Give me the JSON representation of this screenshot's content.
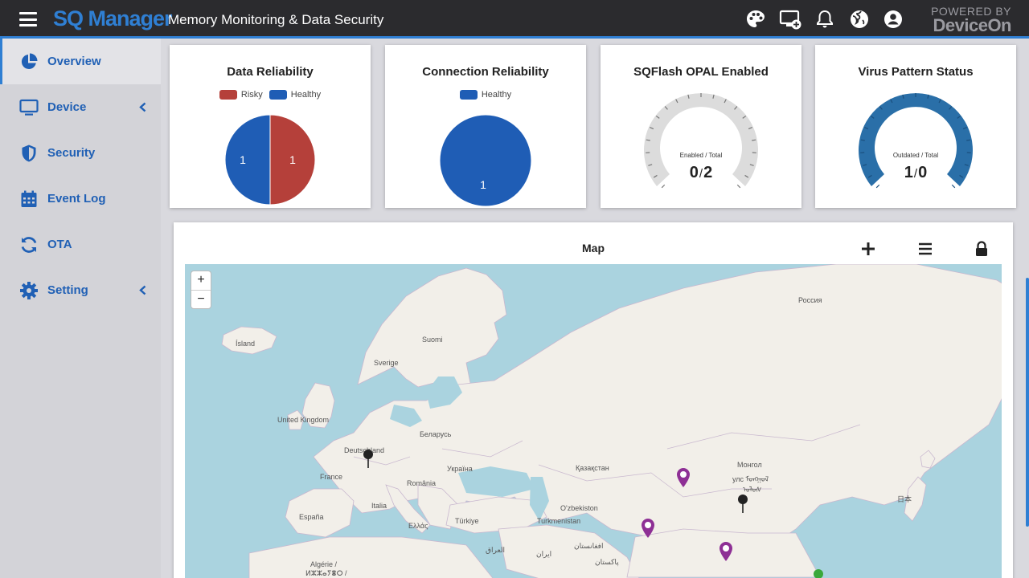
{
  "header": {
    "brand": "SQ Manager",
    "title": "Memory Monitoring & Data Security",
    "powered_by_line1": "POWERED BY",
    "powered_by_line2": "DeviceOn"
  },
  "sidebar": {
    "items": [
      {
        "label": "Overview",
        "icon": "pie-chart-icon",
        "active": true
      },
      {
        "label": "Device",
        "icon": "monitor-icon",
        "has_submenu": true
      },
      {
        "label": "Security",
        "icon": "shield-icon"
      },
      {
        "label": "Event Log",
        "icon": "calendar-icon"
      },
      {
        "label": "OTA",
        "icon": "sync-icon"
      },
      {
        "label": "Setting",
        "icon": "gear-icon",
        "has_submenu": true
      }
    ]
  },
  "cards": {
    "data_reliability": {
      "title": "Data Reliability",
      "legend": [
        "Risky",
        "Healthy"
      ],
      "risky_value": "1",
      "healthy_value": "1"
    },
    "connection_reliability": {
      "title": "Connection Reliability",
      "legend": [
        "Healthy"
      ],
      "healthy_value": "1"
    },
    "sqflash_opal": {
      "title": "SQFlash OPAL Enabled",
      "gauge_label": "Enabled / Total",
      "numerator": "0",
      "separator": "/",
      "denominator": "2",
      "fill_fraction": 0
    },
    "virus_pattern": {
      "title": "Virus Pattern Status",
      "gauge_label": "Outdated / Total",
      "numerator": "1",
      "separator": "/",
      "denominator": "0",
      "fill_fraction": 1
    }
  },
  "map": {
    "title": "Map",
    "zoom_in": "+",
    "zoom_out": "−",
    "labels": {
      "island": "Ísland",
      "suomi": "Suomi",
      "sverige": "Sverige",
      "uk": "United Kingdom",
      "deutschland": "Deutschland",
      "belarus": "Беларусь",
      "france": "France",
      "ukraina": "Україна",
      "romania": "România",
      "italia": "Italia",
      "espana": "España",
      "ellas": "Ελλάς",
      "turkiye": "Türkiye",
      "kazakhstan": "Қазақстан",
      "uzbekistan": "O'zbekiston",
      "turkmenistan": "Turkmenistan",
      "russia": "Россия",
      "mongol1": "Монгол",
      "mongol2": "улс ᠮᠣᠩᠭᠣᠯ",
      "mongol3": "ᠤᠯᠤᠰ",
      "japan": "日本",
      "iraq": "العراق",
      "iran": "ایران",
      "afghanistan": "افغانستان",
      "pakistan": "پاکستان",
      "algerie1": "Algérie /",
      "algerie2": "ⵍⵣⵣⴰⵢⴻⵔ /"
    }
  },
  "colors": {
    "accent": "#2f7fd3",
    "nav_text": "#2060b5",
    "risky": "#b5403a",
    "healthy": "#1f5db5",
    "gauge_grey": "#dcdcdc",
    "gauge_blue": "#2a6fa8",
    "marker_purple": "#8e2f95",
    "marker_black": "#222222",
    "marker_green": "#3aa83a"
  }
}
